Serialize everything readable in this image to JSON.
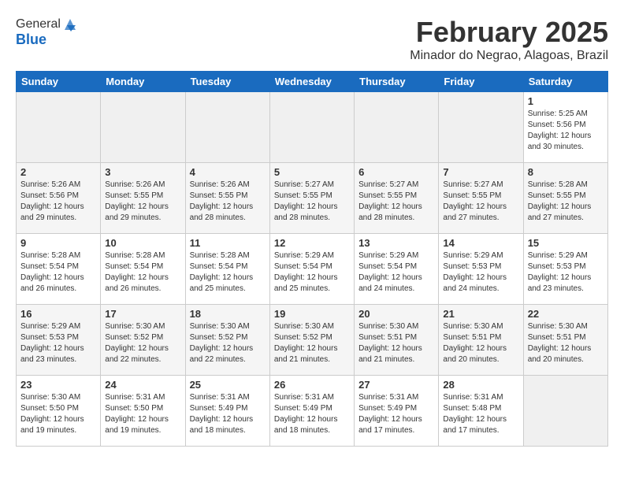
{
  "header": {
    "logo_line1": "General",
    "logo_line2": "Blue",
    "title": "February 2025",
    "subtitle": "Minador do Negrao, Alagoas, Brazil"
  },
  "days_of_week": [
    "Sunday",
    "Monday",
    "Tuesday",
    "Wednesday",
    "Thursday",
    "Friday",
    "Saturday"
  ],
  "weeks": [
    {
      "days": [
        {
          "num": "",
          "info": ""
        },
        {
          "num": "",
          "info": ""
        },
        {
          "num": "",
          "info": ""
        },
        {
          "num": "",
          "info": ""
        },
        {
          "num": "",
          "info": ""
        },
        {
          "num": "",
          "info": ""
        },
        {
          "num": "1",
          "info": "Sunrise: 5:25 AM\nSunset: 5:56 PM\nDaylight: 12 hours and 30 minutes."
        }
      ]
    },
    {
      "days": [
        {
          "num": "2",
          "info": "Sunrise: 5:26 AM\nSunset: 5:56 PM\nDaylight: 12 hours and 29 minutes."
        },
        {
          "num": "3",
          "info": "Sunrise: 5:26 AM\nSunset: 5:55 PM\nDaylight: 12 hours and 29 minutes."
        },
        {
          "num": "4",
          "info": "Sunrise: 5:26 AM\nSunset: 5:55 PM\nDaylight: 12 hours and 28 minutes."
        },
        {
          "num": "5",
          "info": "Sunrise: 5:27 AM\nSunset: 5:55 PM\nDaylight: 12 hours and 28 minutes."
        },
        {
          "num": "6",
          "info": "Sunrise: 5:27 AM\nSunset: 5:55 PM\nDaylight: 12 hours and 28 minutes."
        },
        {
          "num": "7",
          "info": "Sunrise: 5:27 AM\nSunset: 5:55 PM\nDaylight: 12 hours and 27 minutes."
        },
        {
          "num": "8",
          "info": "Sunrise: 5:28 AM\nSunset: 5:55 PM\nDaylight: 12 hours and 27 minutes."
        }
      ]
    },
    {
      "days": [
        {
          "num": "9",
          "info": "Sunrise: 5:28 AM\nSunset: 5:54 PM\nDaylight: 12 hours and 26 minutes."
        },
        {
          "num": "10",
          "info": "Sunrise: 5:28 AM\nSunset: 5:54 PM\nDaylight: 12 hours and 26 minutes."
        },
        {
          "num": "11",
          "info": "Sunrise: 5:28 AM\nSunset: 5:54 PM\nDaylight: 12 hours and 25 minutes."
        },
        {
          "num": "12",
          "info": "Sunrise: 5:29 AM\nSunset: 5:54 PM\nDaylight: 12 hours and 25 minutes."
        },
        {
          "num": "13",
          "info": "Sunrise: 5:29 AM\nSunset: 5:54 PM\nDaylight: 12 hours and 24 minutes."
        },
        {
          "num": "14",
          "info": "Sunrise: 5:29 AM\nSunset: 5:53 PM\nDaylight: 12 hours and 24 minutes."
        },
        {
          "num": "15",
          "info": "Sunrise: 5:29 AM\nSunset: 5:53 PM\nDaylight: 12 hours and 23 minutes."
        }
      ]
    },
    {
      "days": [
        {
          "num": "16",
          "info": "Sunrise: 5:29 AM\nSunset: 5:53 PM\nDaylight: 12 hours and 23 minutes."
        },
        {
          "num": "17",
          "info": "Sunrise: 5:30 AM\nSunset: 5:52 PM\nDaylight: 12 hours and 22 minutes."
        },
        {
          "num": "18",
          "info": "Sunrise: 5:30 AM\nSunset: 5:52 PM\nDaylight: 12 hours and 22 minutes."
        },
        {
          "num": "19",
          "info": "Sunrise: 5:30 AM\nSunset: 5:52 PM\nDaylight: 12 hours and 21 minutes."
        },
        {
          "num": "20",
          "info": "Sunrise: 5:30 AM\nSunset: 5:51 PM\nDaylight: 12 hours and 21 minutes."
        },
        {
          "num": "21",
          "info": "Sunrise: 5:30 AM\nSunset: 5:51 PM\nDaylight: 12 hours and 20 minutes."
        },
        {
          "num": "22",
          "info": "Sunrise: 5:30 AM\nSunset: 5:51 PM\nDaylight: 12 hours and 20 minutes."
        }
      ]
    },
    {
      "days": [
        {
          "num": "23",
          "info": "Sunrise: 5:30 AM\nSunset: 5:50 PM\nDaylight: 12 hours and 19 minutes."
        },
        {
          "num": "24",
          "info": "Sunrise: 5:31 AM\nSunset: 5:50 PM\nDaylight: 12 hours and 19 minutes."
        },
        {
          "num": "25",
          "info": "Sunrise: 5:31 AM\nSunset: 5:49 PM\nDaylight: 12 hours and 18 minutes."
        },
        {
          "num": "26",
          "info": "Sunrise: 5:31 AM\nSunset: 5:49 PM\nDaylight: 12 hours and 18 minutes."
        },
        {
          "num": "27",
          "info": "Sunrise: 5:31 AM\nSunset: 5:49 PM\nDaylight: 12 hours and 17 minutes."
        },
        {
          "num": "28",
          "info": "Sunrise: 5:31 AM\nSunset: 5:48 PM\nDaylight: 12 hours and 17 minutes."
        },
        {
          "num": "",
          "info": ""
        }
      ]
    }
  ]
}
